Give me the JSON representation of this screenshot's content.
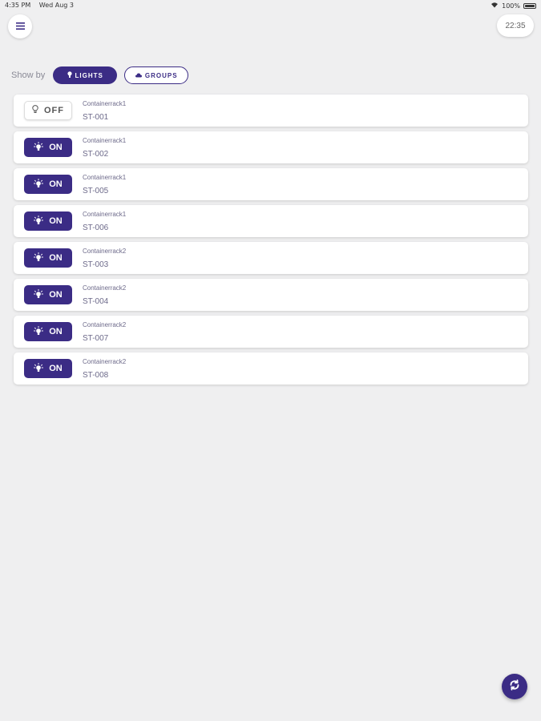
{
  "status_bar": {
    "time": "4:35 PM",
    "date": "Wed Aug 3",
    "battery": "100%"
  },
  "header": {
    "menu_icon": "hamburger-icon",
    "clock": "22:35"
  },
  "filter": {
    "label": "Show by",
    "lights_label": "LIGHTS",
    "groups_label": "GROUPS",
    "active": "lights"
  },
  "lights": [
    {
      "group": "Containerrack1",
      "id": "ST-001",
      "state": "OFF",
      "on": false
    },
    {
      "group": "Containerrack1",
      "id": "ST-002",
      "state": "ON",
      "on": true
    },
    {
      "group": "Containerrack1",
      "id": "ST-005",
      "state": "ON",
      "on": true
    },
    {
      "group": "Containerrack1",
      "id": "ST-006",
      "state": "ON",
      "on": true
    },
    {
      "group": "Containerrack2",
      "id": "ST-003",
      "state": "ON",
      "on": true
    },
    {
      "group": "Containerrack2",
      "id": "ST-004",
      "state": "ON",
      "on": true
    },
    {
      "group": "Containerrack2",
      "id": "ST-007",
      "state": "ON",
      "on": true
    },
    {
      "group": "Containerrack2",
      "id": "ST-008",
      "state": "ON",
      "on": true
    }
  ],
  "colors": {
    "accent": "#3b2c85",
    "background": "#efeff0",
    "card": "#ffffff"
  },
  "fab": {
    "icon": "refresh-icon"
  }
}
